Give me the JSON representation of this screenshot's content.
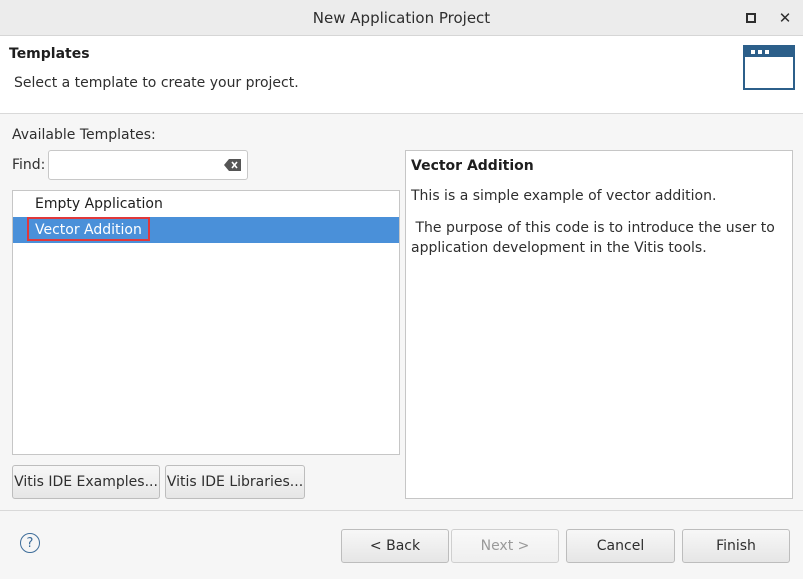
{
  "window": {
    "title": "New Application Project",
    "maximize_icon": "maximize-icon",
    "close_glyph": "✕"
  },
  "header": {
    "title": "Templates",
    "description": "Select a template to create your project.",
    "banner_icon": "window-icon"
  },
  "templates": {
    "available_label": "Available Templates:",
    "find_label": "Find:",
    "find_value": "",
    "items": [
      {
        "label": "Empty Application",
        "selected": false
      },
      {
        "label": "Vector Addition",
        "selected": true
      }
    ],
    "examples_button": "Vitis IDE Examples...",
    "libraries_button": "Vitis IDE Libraries..."
  },
  "description": {
    "title": "Vector Addition",
    "paragraph1": "This is a simple example of vector addition.",
    "paragraph2": " The purpose of this code is to introduce the user to application development in the Vitis tools."
  },
  "footer": {
    "help_glyph": "?",
    "back": "< Back",
    "next": "Next >",
    "cancel": "Cancel",
    "finish": "Finish"
  },
  "colors": {
    "selection": "#4a90d9",
    "highlight_border": "#e0383b",
    "icon_blue": "#2c5f8a"
  }
}
